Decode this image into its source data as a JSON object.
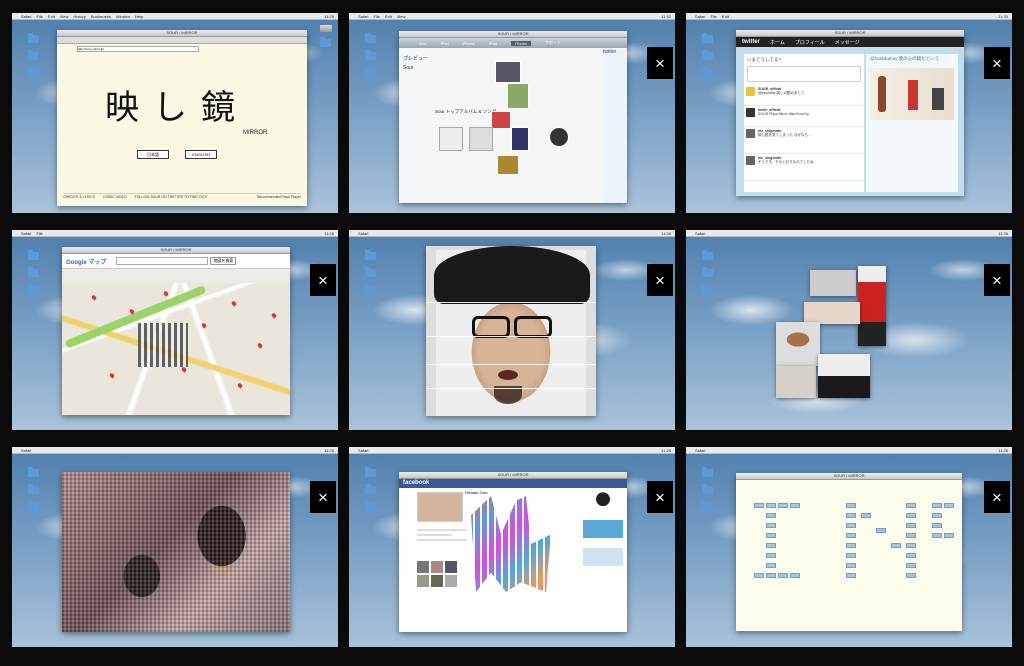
{
  "menubar": {
    "app": "Safari",
    "items": [
      "File",
      "Edit",
      "View",
      "History",
      "Bookmarks",
      "Window",
      "Help"
    ],
    "clocks": [
      "11:25",
      "11:32",
      "11:33",
      "11:26",
      "11:26",
      "11:26",
      "11:26",
      "11:26",
      "11:26"
    ]
  },
  "window_title": "SOUR / MIRROR",
  "panel1": {
    "url": "http://sour-mirror.jp/",
    "kanji": "映し鏡",
    "mirror_word": "MIRROR",
    "btn_ja": "日本語",
    "btn_en": "ENGLISH",
    "footer": [
      "CREDITS & LYRICS",
      "COMIC VIDEO",
      "FOLLOW SOUR ON TWITTER TO FIND OUT!",
      "Recommended Flash Player"
    ]
  },
  "panel2": {
    "tabs": [
      "Mac",
      "iPod",
      "iPhone",
      "iPad",
      "iTunes",
      "サポート"
    ],
    "active_tab": "iTunes",
    "section": "プレビュー",
    "artist": "Sour",
    "album_heading": "Sour トップアルバム & ソング",
    "side_label": "twitter"
  },
  "panel3": {
    "logo": "twitter",
    "nav": [
      "ホーム",
      "プロフィール",
      "メッセージ"
    ],
    "prompt": "いまどうしてる?",
    "handle": "@hoshikahoy 僕の心の鏡だという",
    "tweets": [
      {
        "user": "SOUR_official",
        "text": "@soundfile 映しの鏡のあとで"
      },
      {
        "user": "hoshi_official",
        "text": "SOUR Plays Mirror http://t.co/Ug"
      },
      {
        "user": "hie_shigesato",
        "text": "映し鏡を見てしまった なぜなら..."
      },
      {
        "user": "hie_shigesato",
        "text": "そうです。そのとおりなのでしたね"
      }
    ]
  },
  "panel4": {
    "logo": "Google マップ",
    "search_button": "地図を検索"
  },
  "panel8": {
    "logo": "facebook",
    "name": "Hiroaki Ono"
  }
}
